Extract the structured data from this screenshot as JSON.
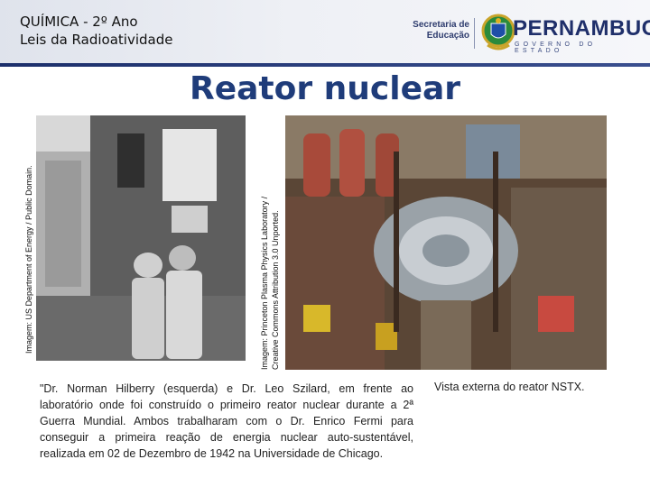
{
  "header": {
    "line1": "QUÍMICA - 2º Ano",
    "line2": "Leis da Radioatividade",
    "secretaria_line1": "Secretaria de",
    "secretaria_line2": "Educação",
    "state_name": "PERNAMBUCO",
    "state_subtitle": "GOVERNO DO ESTADO"
  },
  "slide": {
    "title": "Reator nuclear"
  },
  "images": {
    "left_credit": "Imagem: US Department of Energy / Public Domain.",
    "right_credit_line1": "Imagem: Princeton Plasma Physics Laboratory /",
    "right_credit_line2": "Creative Commons Attribution 3.0 Unported."
  },
  "captions": {
    "left": "\"Dr. Norman Hilberry (esquerda) e Dr. Leo Szilard, em frente ao laboratório onde foi construído o primeiro reator nuclear durante a 2ª Guerra Mundial. Ambos trabalharam com o Dr. Enrico Fermi para conseguir a primeira reação de energia nuclear auto-sustentável, realizada em 02 de Dezembro de 1942 na Universidade de Chicago.",
    "right": "Vista externa do reator NSTX."
  },
  "colors": {
    "title": "#1f3c7a",
    "header_rule": "#1c2f6b",
    "brand": "#1f2f6a"
  }
}
